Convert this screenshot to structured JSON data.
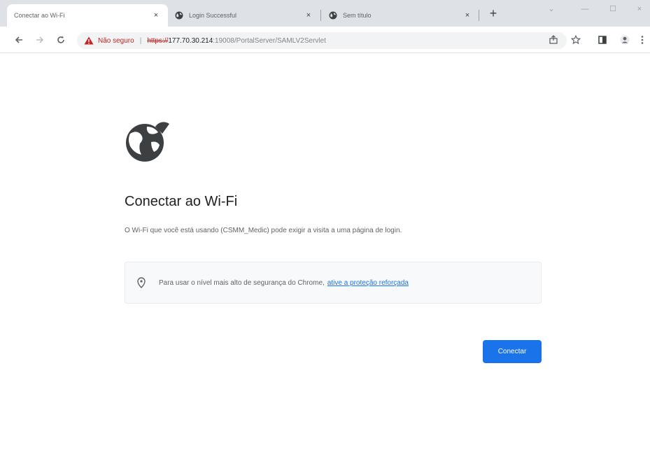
{
  "tabs": [
    {
      "label": "Conectar ao Wi-Fi",
      "close": "×"
    },
    {
      "label": "Login Successful",
      "close": "×"
    },
    {
      "label": "Sem título",
      "close": "×"
    }
  ],
  "newtab": "+",
  "window_controls": {
    "minimize": "—",
    "restore": "☐",
    "close": "×"
  },
  "omnibox": {
    "security_label": "Não seguro",
    "separator": "|",
    "url_scheme": "https://",
    "url_host": "177.70.30.214",
    "url_path": ":19008/PortalServer/SAMLV2Servlet"
  },
  "page": {
    "title": "Conectar ao Wi-Fi",
    "description": "O Wi-Fi que você está usando (CSMM_Medic) pode exigir a visita a uma página de login.",
    "info_text": "Para usar o nível mais alto de segurança do Chrome,",
    "info_link": "ative a proteção reforçada",
    "connect_button": "Conectar"
  },
  "colors": {
    "accent": "#1a73e8",
    "warning": "#c5221f"
  }
}
